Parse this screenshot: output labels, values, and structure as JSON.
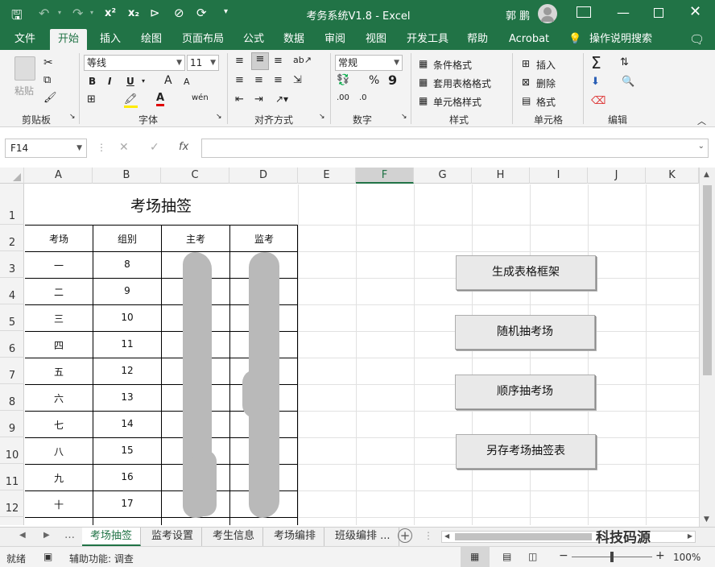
{
  "window": {
    "title": "考务系统V1.8  -  Excel",
    "user": "郭 鹏",
    "qat_items": [
      "x²",
      "x₂"
    ]
  },
  "ribbon_tabs": [
    "文件",
    "开始",
    "插入",
    "绘图",
    "页面布局",
    "公式",
    "数据",
    "审阅",
    "视图",
    "开发工具",
    "帮助",
    "Acrobat"
  ],
  "tell_me": "操作说明搜索",
  "ribbon": {
    "clipboard": {
      "paste": "粘贴",
      "label": "剪贴板"
    },
    "font": {
      "name": "等线",
      "size": "11",
      "label": "字体",
      "bold": "B",
      "italic": "I",
      "underline": "U",
      "grow": "A",
      "shrink": "A",
      "phonetic": "wén"
    },
    "alignment": {
      "label": "对齐方式"
    },
    "number": {
      "format": "常规",
      "label": "数字",
      "percent": "%",
      "comma": "9"
    },
    "styles": {
      "conditional": "条件格式",
      "table": "套用表格格式",
      "cell": "单元格样式",
      "label": "样式"
    },
    "cells": {
      "insert": "插入",
      "delete": "删除",
      "format": "格式",
      "label": "单元格"
    },
    "editing": {
      "label": "编辑"
    }
  },
  "formula_bar": {
    "name_box": "F14",
    "fx": "fx",
    "formula": ""
  },
  "columns": [
    "A",
    "B",
    "C",
    "D",
    "E",
    "F",
    "G",
    "H",
    "I",
    "J",
    "K"
  ],
  "selected_column": "F",
  "rows": [
    "1",
    "2",
    "3",
    "4",
    "5",
    "6",
    "7",
    "8",
    "9",
    "10",
    "11",
    "12"
  ],
  "table": {
    "title": "考场抽签",
    "headers": [
      "考场",
      "组别",
      "主考",
      "监考"
    ],
    "rows": [
      [
        "一",
        "8",
        "",
        ""
      ],
      [
        "二",
        "9",
        "",
        ""
      ],
      [
        "三",
        "10",
        "",
        ""
      ],
      [
        "四",
        "11",
        "",
        ""
      ],
      [
        "五",
        "12",
        "",
        ""
      ],
      [
        "六",
        "13",
        "",
        ""
      ],
      [
        "七",
        "14",
        "",
        ""
      ],
      [
        "八",
        "15",
        "",
        ""
      ],
      [
        "九",
        "16",
        "",
        ""
      ],
      [
        "十",
        "17",
        "",
        ""
      ]
    ]
  },
  "buttons": [
    "生成表格框架",
    "随机抽考场",
    "顺序抽考场",
    "另存考场抽签表"
  ],
  "sheet_tabs": [
    "考场抽签",
    "监考设置",
    "考生信息",
    "考场编排",
    "班级编排 ..."
  ],
  "active_sheet": "考场抽签",
  "watermark": "科技码源",
  "status": {
    "ready": "就绪",
    "accessibility": "辅助功能: 调查",
    "zoom": "100%"
  }
}
